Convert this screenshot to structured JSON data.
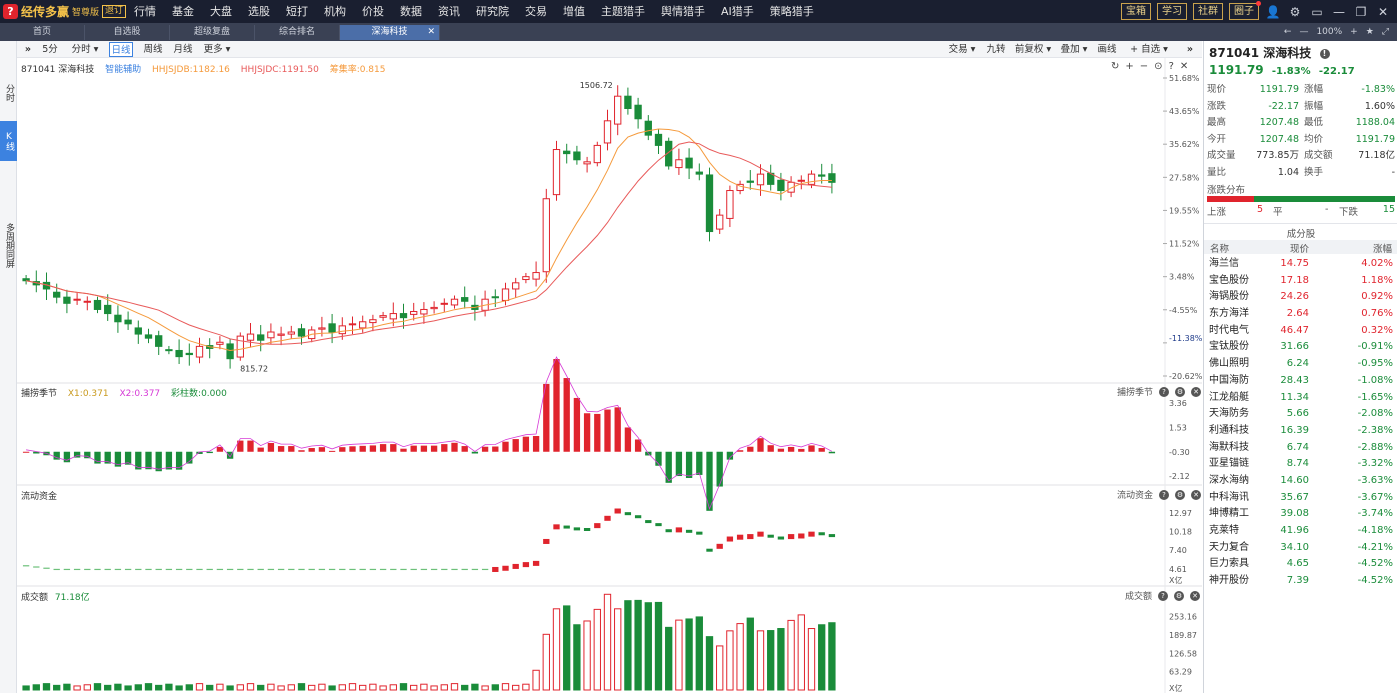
{
  "app": {
    "logo_mark": "?",
    "logo_name": "经传多赢",
    "edition": "智尊版",
    "edition_tag": "退订",
    "nav": [
      "行情",
      "基金",
      "大盘",
      "选股",
      "短打",
      "机构",
      "价投",
      "数据",
      "资讯",
      "研究院",
      "交易",
      "增值",
      "主题猎手",
      "舆情猎手",
      "AI猎手",
      "策略猎手"
    ],
    "nav_dot_index": 7,
    "top_buttons": [
      "宝箱",
      "学习",
      "社群",
      "圈子"
    ],
    "top_button_dot_index": 3,
    "icons": [
      "user-icon",
      "gear-icon",
      "window-icon",
      "minimize-icon",
      "restore-icon",
      "close-icon"
    ]
  },
  "tabs": {
    "items": [
      "首页",
      "自选股",
      "超级复盘",
      "综合排名",
      "深海科技"
    ],
    "active_index": 4,
    "right": [
      "←",
      "—",
      "100%",
      "+",
      "★",
      "⤢"
    ]
  },
  "side": {
    "items": [
      "分时",
      "K线",
      "多周期同屏"
    ],
    "active_index": 1
  },
  "toolbar": {
    "left": [
      "5分",
      "分时 ▾",
      "日线",
      "周线",
      "月线",
      "更多 ▾"
    ],
    "active_index": 2,
    "right": [
      "交易 ▾",
      "九转",
      "前复权 ▾",
      "叠加 ▾",
      "画线",
      "+ 自选 ▾"
    ]
  },
  "main_panel": {
    "code_name": "871041 深海科技",
    "assist": "智能辅助",
    "ind1": "HHJSJDB:1182.16",
    "ind2": "HHJSJDC:1191.50",
    "ind3": "筹集率:0.815",
    "high_label": "1506.72",
    "low_label": "815.72",
    "current_label": "-11.38%",
    "pct_ticks": [
      "51.68%",
      "43.65%",
      "35.62%",
      "27.58%",
      "19.55%",
      "11.52%",
      "3.48%",
      "-4.55%",
      "-12.58%",
      "-20.62%"
    ],
    "right_icons": [
      "↻",
      "+",
      "−",
      "⊙",
      "?",
      "✕"
    ]
  },
  "osc_panel": {
    "title": "捕捞季节",
    "x1": "X1:0.371",
    "x2": "X2:0.377",
    "bars": "彩柱数:0.000",
    "ticks": [
      "3.36",
      "1.53",
      "-0.30",
      "-2.12"
    ]
  },
  "flow_panel": {
    "title": "流动资金",
    "ticks": [
      "12.97",
      "10.18",
      "7.40",
      "4.61"
    ],
    "unit": "X亿"
  },
  "vol_panel": {
    "title": "成交额",
    "value": "71.18亿",
    "ticks": [
      "253.16",
      "189.87",
      "126.58",
      "63.29"
    ],
    "unit": "X亿"
  },
  "quote": {
    "code": "871041",
    "name": "深海科技",
    "price": "1191.79",
    "change_pct": "-1.83%",
    "change": "-22.17",
    "rows": [
      {
        "l1": "现价",
        "v1": "1191.79",
        "c1": "green",
        "l2": "涨幅",
        "v2": "-1.83%",
        "c2": "green"
      },
      {
        "l1": "涨跌",
        "v1": "-22.17",
        "c1": "green",
        "l2": "振幅",
        "v2": "1.60%",
        "c2": "dark"
      },
      {
        "l1": "最高",
        "v1": "1207.48",
        "c1": "green",
        "l2": "最低",
        "v2": "1188.04",
        "c2": "green"
      },
      {
        "l1": "今开",
        "v1": "1207.48",
        "c1": "green",
        "l2": "均价",
        "v2": "1191.79",
        "c2": "green"
      },
      {
        "l1": "成交量",
        "v1": "773.85万",
        "c1": "dark",
        "l2": "成交额",
        "v2": "71.18亿",
        "c2": "dark"
      },
      {
        "l1": "量比",
        "v1": "1.04",
        "c1": "dark",
        "l2": "换手",
        "v2": "-",
        "c2": "dark"
      }
    ],
    "dist_title": "涨跌分布",
    "up_label": "上涨",
    "up_count": "5",
    "flat_label": "平",
    "flat_count": "-",
    "down_label": "下跌",
    "down_count": "15",
    "up_fraction": 0.25
  },
  "components": {
    "title": "成分股",
    "headers": [
      "名称",
      "现价",
      "涨幅"
    ],
    "rows": [
      {
        "name": "海兰信",
        "price": "14.75",
        "pct": "4.02%",
        "up": true
      },
      {
        "name": "宝色股份",
        "price": "17.18",
        "pct": "1.18%",
        "up": true
      },
      {
        "name": "海锅股份",
        "price": "24.26",
        "pct": "0.92%",
        "up": true
      },
      {
        "name": "东方海洋",
        "price": "2.64",
        "pct": "0.76%",
        "up": true
      },
      {
        "name": "时代电气",
        "price": "46.47",
        "pct": "0.32%",
        "up": true
      },
      {
        "name": "宝钛股份",
        "price": "31.66",
        "pct": "-0.91%",
        "up": false
      },
      {
        "name": "佛山照明",
        "price": "6.24",
        "pct": "-0.95%",
        "up": false
      },
      {
        "name": "中国海防",
        "price": "28.43",
        "pct": "-1.08%",
        "up": false
      },
      {
        "name": "江龙船艇",
        "price": "11.34",
        "pct": "-1.65%",
        "up": false
      },
      {
        "name": "天海防务",
        "price": "5.66",
        "pct": "-2.08%",
        "up": false
      },
      {
        "name": "利通科技",
        "price": "16.39",
        "pct": "-2.38%",
        "up": false
      },
      {
        "name": "海默科技",
        "price": "6.74",
        "pct": "-2.88%",
        "up": false
      },
      {
        "name": "亚星锚链",
        "price": "8.74",
        "pct": "-3.32%",
        "up": false
      },
      {
        "name": "深水海纳",
        "price": "14.60",
        "pct": "-3.63%",
        "up": false
      },
      {
        "name": "中科海讯",
        "price": "35.67",
        "pct": "-3.67%",
        "up": false
      },
      {
        "name": "坤博精工",
        "price": "39.08",
        "pct": "-3.74%",
        "up": false
      },
      {
        "name": "克莱特",
        "price": "41.96",
        "pct": "-4.18%",
        "up": false
      },
      {
        "name": "天力复合",
        "price": "34.10",
        "pct": "-4.21%",
        "up": false
      },
      {
        "name": "巨力索具",
        "price": "4.65",
        "pct": "-4.52%",
        "up": false
      },
      {
        "name": "神开股份",
        "price": "7.39",
        "pct": "-4.52%",
        "up": false
      }
    ]
  },
  "chart_data": {
    "type": "candlestick",
    "series_close": [
      1030,
      1020,
      1010,
      990,
      975,
      985,
      980,
      960,
      950,
      930,
      925,
      900,
      890,
      870,
      860,
      845,
      850,
      870,
      865,
      880,
      840,
      895,
      900,
      885,
      905,
      900,
      905,
      895,
      910,
      915,
      905,
      920,
      925,
      930,
      935,
      945,
      950,
      940,
      955,
      960,
      965,
      975,
      985,
      980,
      960,
      985,
      990,
      1010,
      1025,
      1040,
      1050,
      1230,
      1350,
      1340,
      1325,
      1320,
      1360,
      1420,
      1480,
      1450,
      1425,
      1385,
      1360,
      1310,
      1325,
      1305,
      1290,
      1150,
      1190,
      1250,
      1265,
      1270,
      1290,
      1265,
      1250,
      1270,
      1275,
      1290,
      1285,
      1270
    ],
    "pct_ticks": [
      51.68,
      43.65,
      35.62,
      27.58,
      19.55,
      11.52,
      3.48,
      -4.55,
      -12.58,
      -20.62
    ],
    "osc_ticks": [
      3.36,
      1.53,
      -0.3,
      -2.12
    ],
    "flow_ticks": [
      12.97,
      10.18,
      7.4,
      4.61
    ],
    "vol_ticks": [
      253.16,
      189.87,
      126.58,
      63.29
    ],
    "colors": {
      "up": "#e0242d",
      "down": "#1a8c3a",
      "ma1": "#f59a3c",
      "ma2": "#e85a5a"
    }
  }
}
